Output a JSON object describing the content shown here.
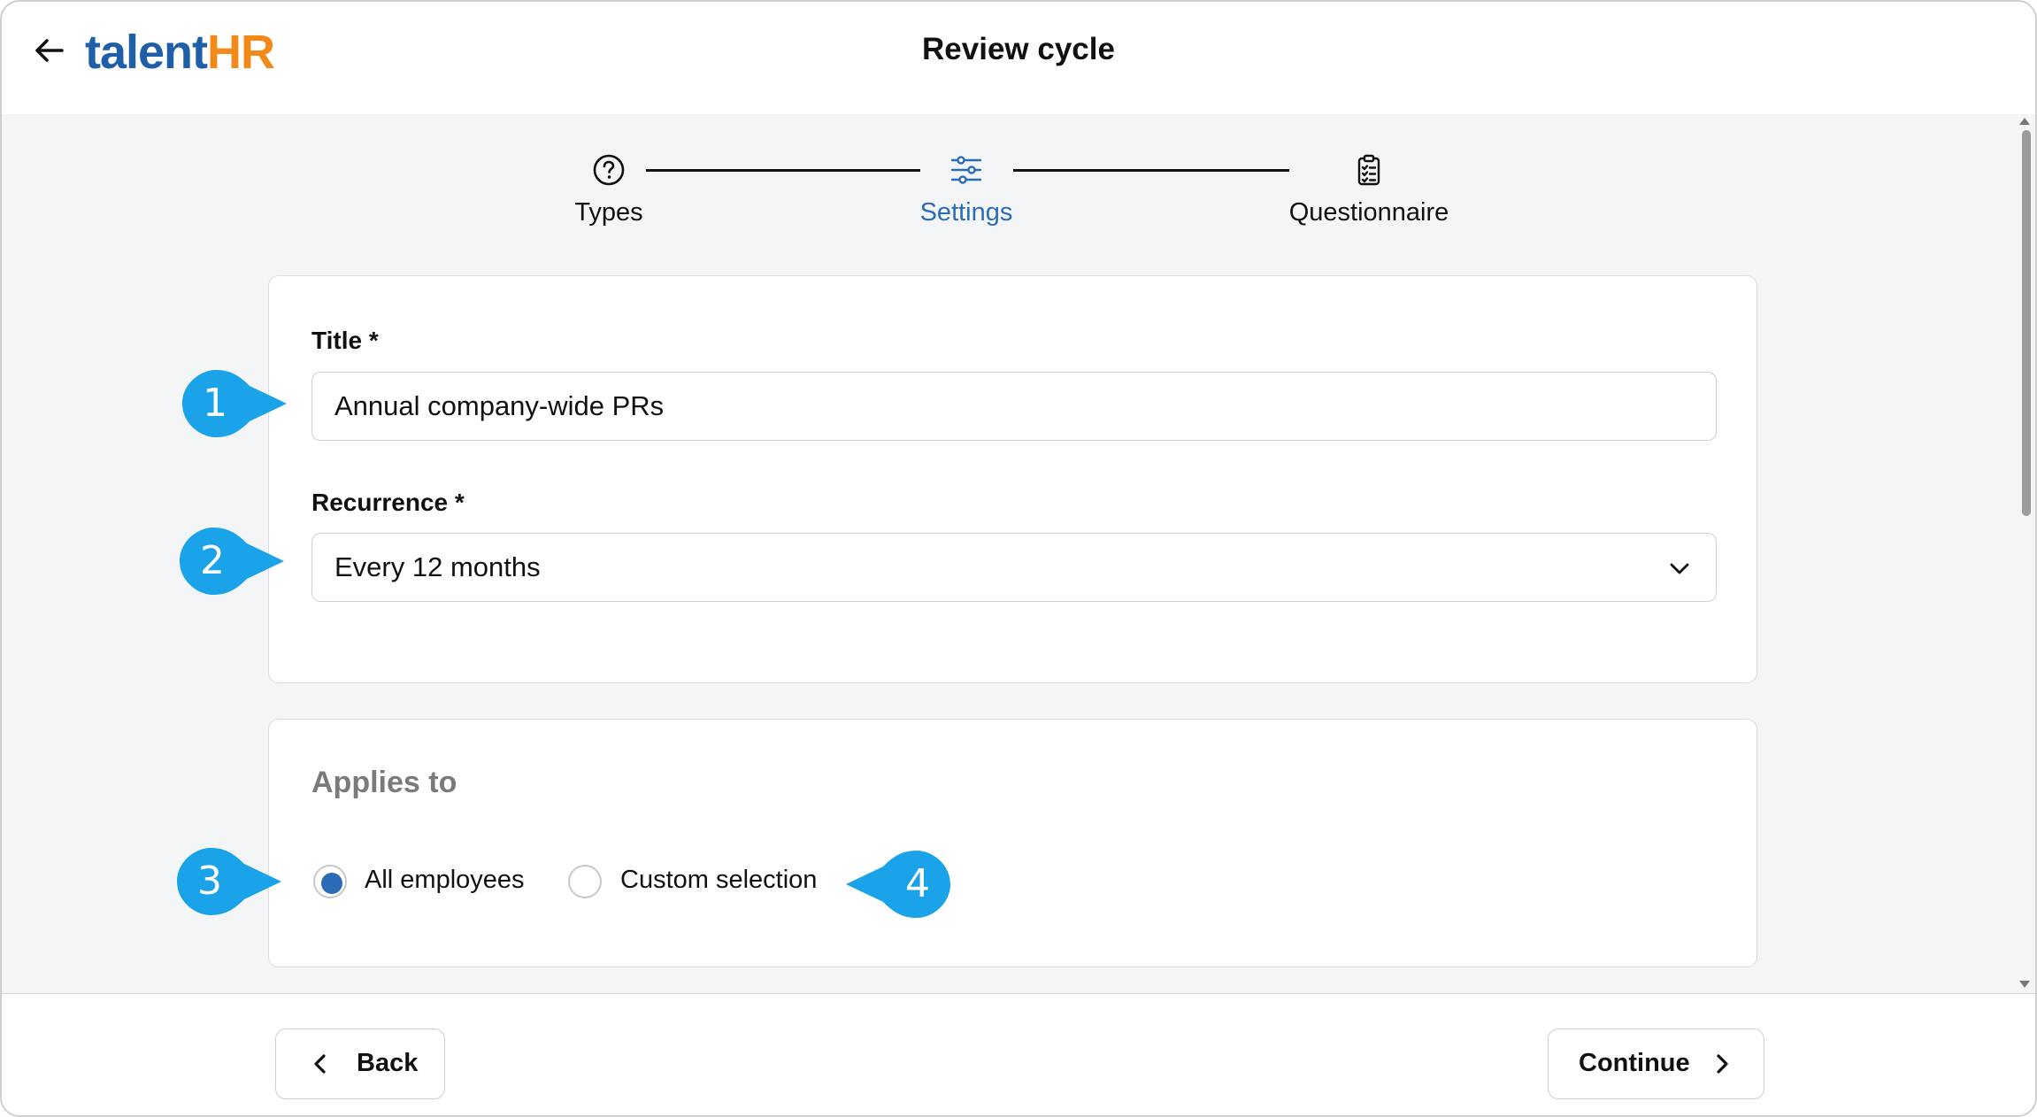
{
  "header": {
    "back_icon": "arrow-left-icon",
    "logo_text_main": "talent",
    "logo_text_accent": "HR",
    "title": "Review cycle"
  },
  "stepper": {
    "steps": [
      {
        "label": "Types",
        "icon": "question-circle-icon",
        "active": false
      },
      {
        "label": "Settings",
        "icon": "sliders-icon",
        "active": true
      },
      {
        "label": "Questionnaire",
        "icon": "clipboard-checklist-icon",
        "active": false
      }
    ]
  },
  "settings_card": {
    "title_label": "Title *",
    "title_value": "Annual company-wide PRs",
    "recurrence_label": "Recurrence *",
    "recurrence_value": "Every 12 months"
  },
  "applies_card": {
    "heading": "Applies to",
    "options": [
      {
        "label": "All employees",
        "checked": true
      },
      {
        "label": "Custom selection",
        "checked": false
      }
    ]
  },
  "callouts": [
    "1",
    "2",
    "3",
    "4"
  ],
  "footer": {
    "back_label": "Back",
    "continue_label": "Continue"
  },
  "colors": {
    "accent_blue": "#2b6cb8",
    "logo_blue": "#1f5fa8",
    "logo_orange": "#f28a1a",
    "callout_blue": "#1aa3e8",
    "content_bg": "#f4f5f7"
  }
}
